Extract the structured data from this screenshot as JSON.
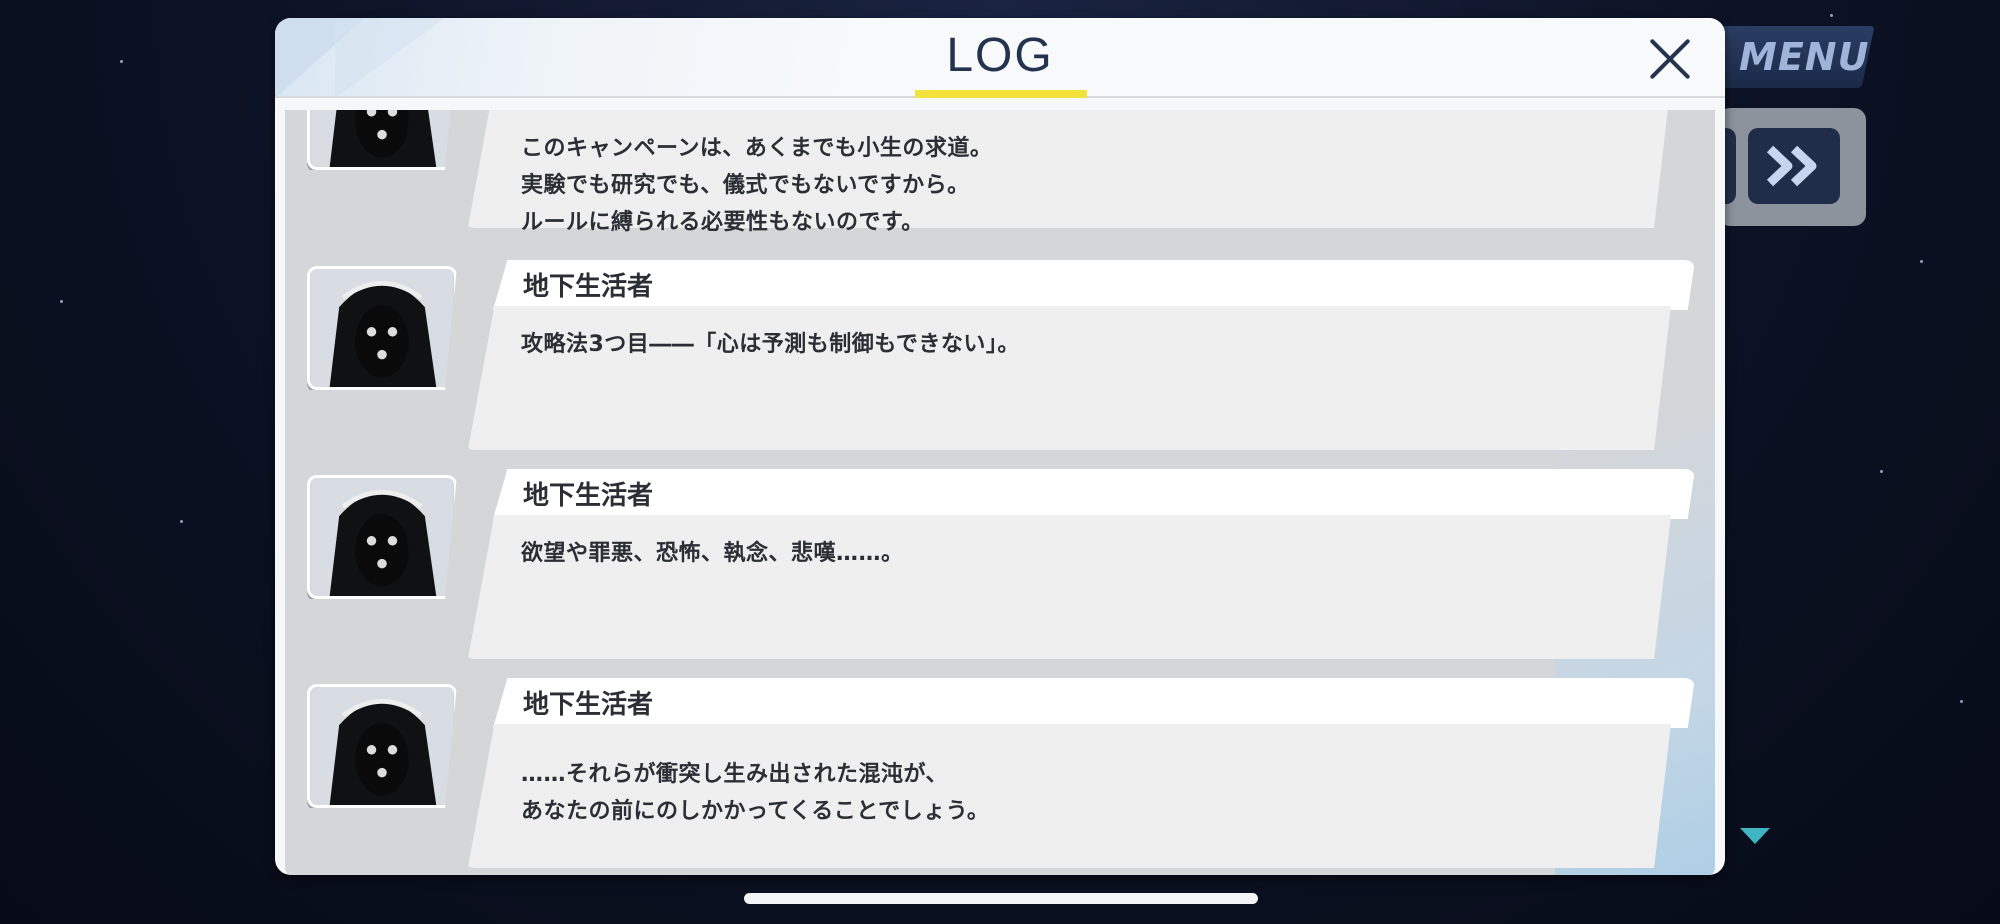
{
  "hud": {
    "menu_label": "MENU",
    "fast_forward_icon": "fast-forward-icon"
  },
  "log": {
    "title": "LOG",
    "close_icon": "close-icon",
    "entries": [
      {
        "speaker": "",
        "lines": [
          "このキャンペーンは、あくまでも小生の求道。",
          "実験でも研究でも、儀式でもないですから。",
          "ルールに縛られる必要性もないのです。"
        ]
      },
      {
        "speaker": "地下生活者",
        "lines": [
          "攻略法3つ目――「心は予測も制御もできない」。"
        ]
      },
      {
        "speaker": "地下生活者",
        "lines": [
          "欲望や罪悪、恐怖、執念、悲嘆……。"
        ]
      },
      {
        "speaker": "地下生活者",
        "lines": [
          "……それらが衝突し生み出された混沌が、",
          "あなたの前にのしかかってくることでしょう。"
        ]
      }
    ]
  },
  "colors": {
    "accent_yellow": "#f4e23c",
    "title_navy": "#24344e",
    "hud_teal": "#3fb5c4"
  }
}
